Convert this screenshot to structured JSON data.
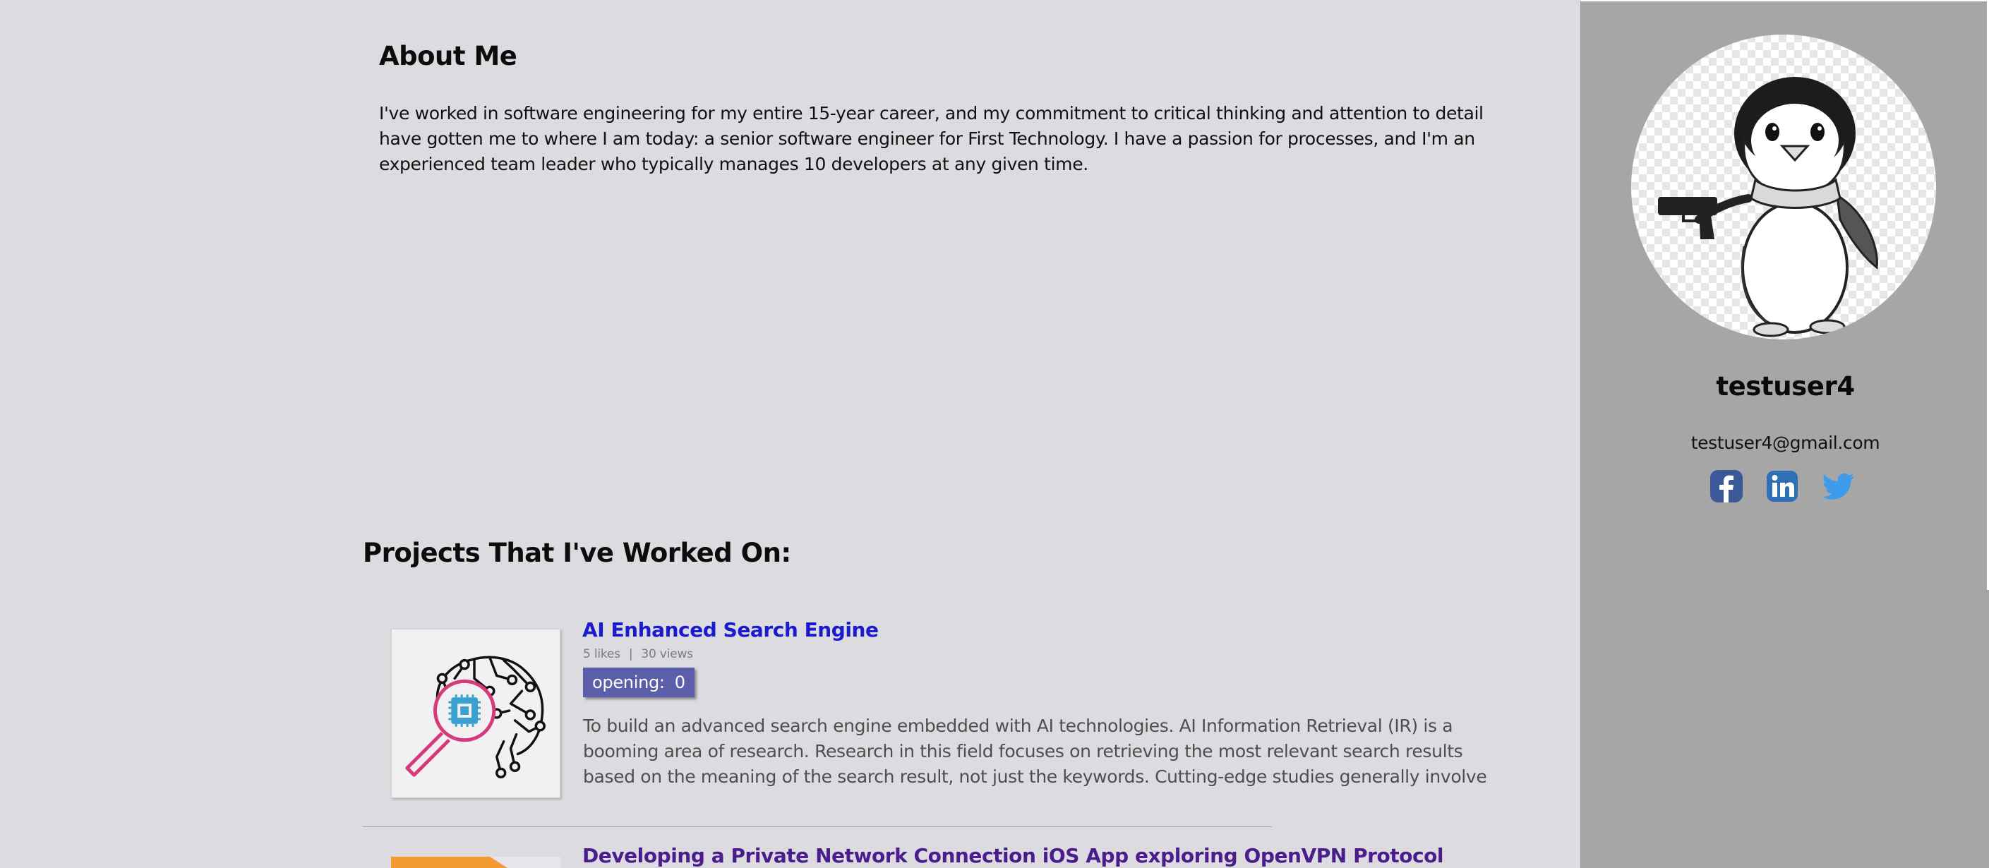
{
  "about": {
    "title": "About Me",
    "text": "I've worked in software engineering for my entire 15-year career, and my commitment to critical thinking and attention to detail have gotten me to where I am today: a senior software engineer for First Technology. I have a passion for processes, and I'm an experienced team leader who typically manages 10 developers at any given time."
  },
  "projects": {
    "heading": "Projects That I've Worked On:",
    "items": [
      {
        "title": "AI Enhanced Search Engine",
        "likes": "5 likes",
        "separator": "|",
        "views": "30 views",
        "opening_label": "opening:",
        "opening_count": "0",
        "description": "To build an advanced search engine embedded with AI technologies. AI Information Retrieval (IR) is a booming area of research. Research in this field focuses on retrieving the most relevant search results based on the meaning of the search result, not just the keywords. Cutting-edge studies generally involve taking",
        "thumbnail_icon": "ai-brain-search-icon"
      },
      {
        "title": "Developing a Private Network Connection iOS App exploring OpenVPN Protocol",
        "thumbnail_icon": "vpn-app-thumbnail"
      }
    ]
  },
  "profile": {
    "username": "testuser4",
    "email": "testuser4@gmail.com",
    "avatar_icon": "penguin-avatar",
    "social": [
      "facebook-icon",
      "linkedin-icon",
      "twitter-icon"
    ]
  },
  "colors": {
    "page_bg": "#dcdbe0",
    "sidebar_bg": "#a6a6a6",
    "link_blue": "#1a1ad0",
    "link_visited": "#4b1d8c",
    "badge_bg": "#5b5ea8",
    "facebook": "#3b5998",
    "linkedin": "#2f6fb5",
    "twitter": "#3d9be9"
  }
}
